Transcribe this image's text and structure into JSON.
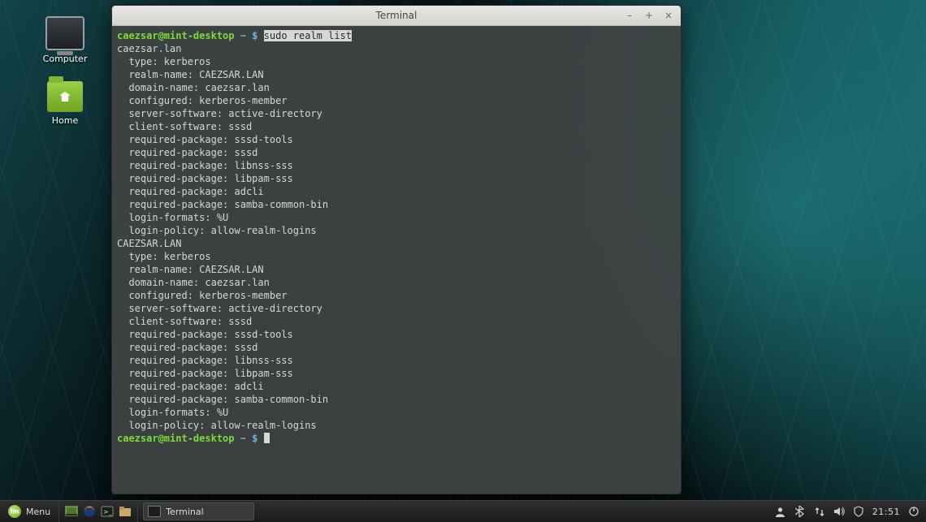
{
  "desktop": {
    "icons": [
      {
        "name": "computer",
        "label": "Computer"
      },
      {
        "name": "home",
        "label": "Home"
      }
    ]
  },
  "window": {
    "title": "Terminal",
    "controls": {
      "minimize": "–",
      "maximize": "+",
      "close": "×"
    }
  },
  "terminal": {
    "prompt": {
      "user_host": "caezsar@mint-desktop",
      "path": "~",
      "symbol": "$"
    },
    "command": "sudo realm list",
    "output_lines": [
      "caezsar.lan",
      "  type: kerberos",
      "  realm-name: CAEZSAR.LAN",
      "  domain-name: caezsar.lan",
      "  configured: kerberos-member",
      "  server-software: active-directory",
      "  client-software: sssd",
      "  required-package: sssd-tools",
      "  required-package: sssd",
      "  required-package: libnss-sss",
      "  required-package: libpam-sss",
      "  required-package: adcli",
      "  required-package: samba-common-bin",
      "  login-formats: %U",
      "  login-policy: allow-realm-logins",
      "CAEZSAR.LAN",
      "  type: kerberos",
      "  realm-name: CAEZSAR.LAN",
      "  domain-name: caezsar.lan",
      "  configured: kerberos-member",
      "  server-software: active-directory",
      "  client-software: sssd",
      "  required-package: sssd-tools",
      "  required-package: sssd",
      "  required-package: libnss-sss",
      "  required-package: libpam-sss",
      "  required-package: adcli",
      "  required-package: samba-common-bin",
      "  login-formats: %U",
      "  login-policy: allow-realm-logins"
    ]
  },
  "panel": {
    "menu_label": "Menu",
    "quick_launch": [
      {
        "name": "show-desktop",
        "glyph": "▥"
      },
      {
        "name": "firefox",
        "glyph": ""
      },
      {
        "name": "terminal",
        "glyph": ""
      },
      {
        "name": "files",
        "glyph": ""
      }
    ],
    "tasks": [
      {
        "name": "terminal-task",
        "label": "Terminal"
      }
    ],
    "tray": [
      {
        "name": "user-icon",
        "glyph": "👤"
      },
      {
        "name": "bluetooth-icon",
        "glyph": "⎓"
      },
      {
        "name": "network-icon",
        "glyph": "⇅"
      },
      {
        "name": "volume-icon",
        "glyph": "🔊"
      },
      {
        "name": "shield-icon",
        "glyph": "◈"
      }
    ],
    "clock": "21:51"
  },
  "colors": {
    "prompt_user": "#7bdc3a",
    "prompt_path": "#6fbad8",
    "terminal_bg": "rgba(65,68,68,0.93)"
  }
}
